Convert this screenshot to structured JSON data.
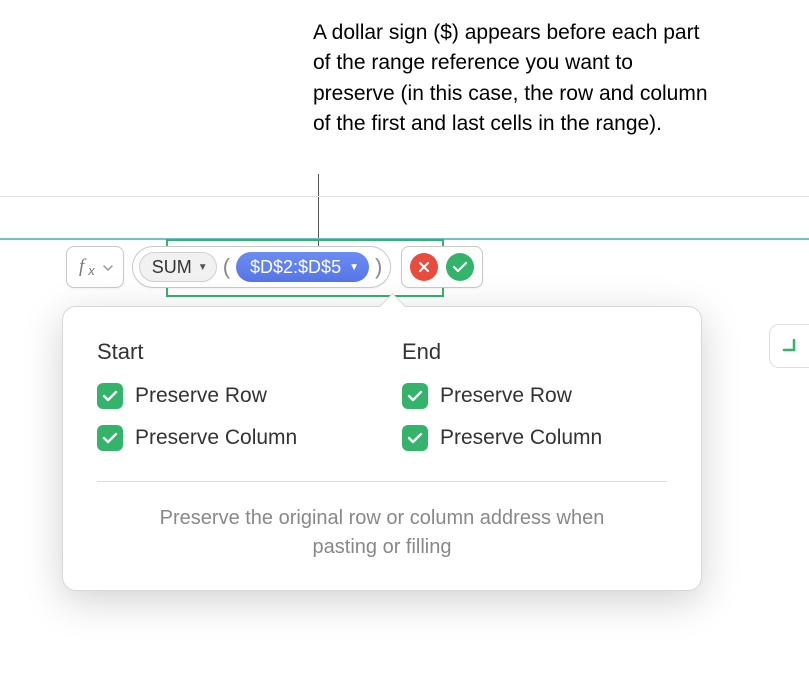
{
  "callout": "A dollar sign ($) appears before each part of the range reference you want to preserve (in this case, the row and column of the first and last cells in the range).",
  "formula": {
    "function_name": "SUM",
    "range_ref": "$D$2:$D$5"
  },
  "popover": {
    "start": {
      "heading": "Start",
      "preserve_row": "Preserve Row",
      "preserve_column": "Preserve Column"
    },
    "end": {
      "heading": "End",
      "preserve_row": "Preserve Row",
      "preserve_column": "Preserve Column"
    },
    "description": "Preserve the original row or column address when pasting or filling"
  }
}
